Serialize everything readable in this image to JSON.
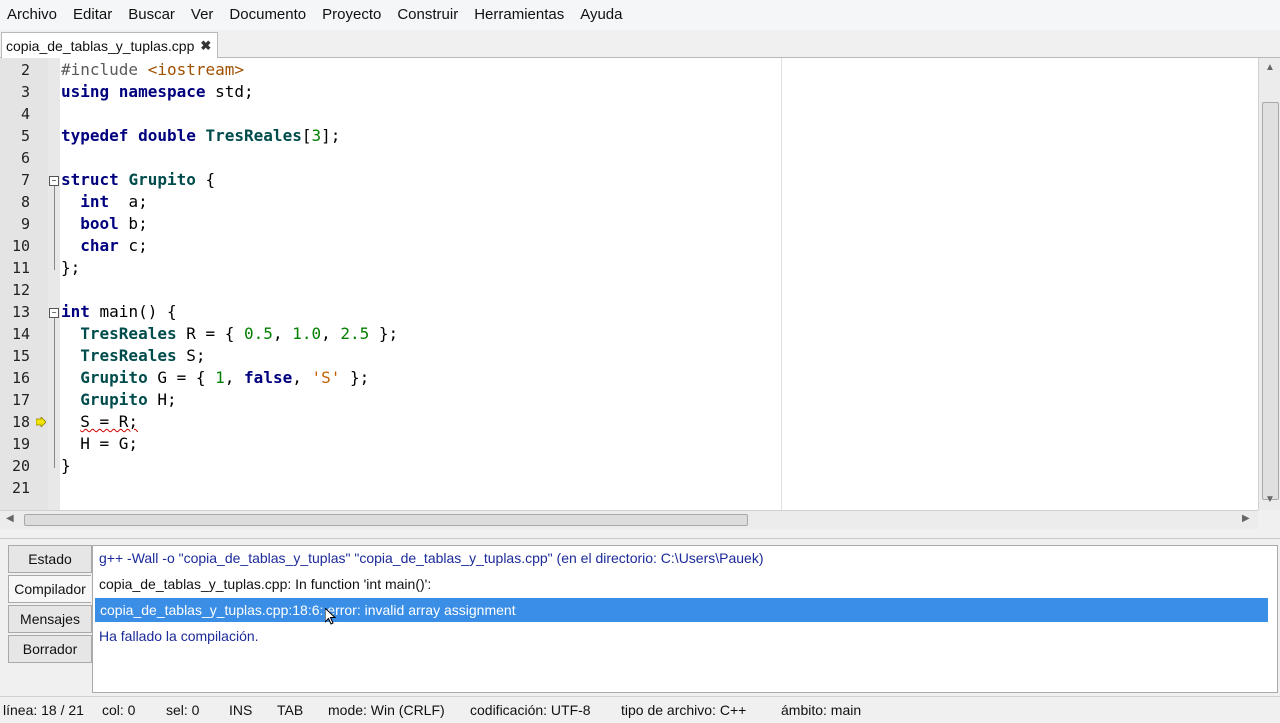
{
  "menu": [
    "Archivo",
    "Editar",
    "Buscar",
    "Ver",
    "Documento",
    "Proyecto",
    "Construir",
    "Herramientas",
    "Ayuda"
  ],
  "tab": {
    "filename": "copia_de_tablas_y_tuplas.cpp",
    "close": "✖"
  },
  "editor": {
    "line_numbers": [
      "2",
      "3",
      "4",
      "5",
      "6",
      "7",
      "8",
      "9",
      "10",
      "11",
      "12",
      "13",
      "14",
      "15",
      "16",
      "17",
      "18",
      "19",
      "20",
      "21"
    ],
    "code": {
      "l2a": "#include ",
      "l2b": "<iostream>",
      "l3a": "using namespace",
      "l3b": " std;",
      "l5a": "typedef double ",
      "l5b": "TresReales",
      "l5c": "[",
      "l5d": "3",
      "l5e": "];",
      "l7a": "struct ",
      "l7b": "Grupito",
      "l7c": " {",
      "l8a": "  int",
      "l8b": "  a;",
      "l9a": "  bool",
      "l9b": " b;",
      "l10a": "  char",
      "l10b": " c;",
      "l11": "};",
      "l13a": "int",
      "l13b": " main() {",
      "l14a": "  TresReales",
      "l14b": " R = { ",
      "l14c": "0.5",
      "l14d": ", ",
      "l14e": "1.0",
      "l14f": ", ",
      "l14g": "2.5",
      "l14h": " };",
      "l15a": "  TresReales",
      "l15b": " S;",
      "l16a": "  Grupito",
      "l16b": " G = { ",
      "l16c": "1",
      "l16d": ", ",
      "l16e": "false",
      "l16f": ", ",
      "l16g": "'S'",
      "l16h": " };",
      "l17a": "  Grupito",
      "l17b": " H;",
      "l18pre": "  ",
      "l18": "S = R;",
      "l19": "  H = G;",
      "l20": "}"
    }
  },
  "panel": {
    "tabs": [
      "Estado",
      "Compilador",
      "Mensajes",
      "Borrador"
    ],
    "active_tab": "Compilador",
    "messages": [
      "g++ -Wall -o \"copia_de_tablas_y_tuplas\" \"copia_de_tablas_y_tuplas.cpp\" (en el directorio: C:\\Users\\Pauek)",
      "copia_de_tablas_y_tuplas.cpp: In function 'int main()':",
      "copia_de_tablas_y_tuplas.cpp:18:6: error: invalid array assignment",
      "Ha fallado la compilación."
    ]
  },
  "status": {
    "line": "línea: 18 / 21",
    "col": "col: 0",
    "sel": "sel: 0",
    "ins": "INS",
    "tab": "TAB",
    "mode": "mode: Win (CRLF)",
    "encoding": "codificación: UTF-8",
    "filetype": "tipo de archivo: C++",
    "scope": "ámbito: main"
  },
  "icons": {
    "fold": "minus-box",
    "marker": "arrow-marker",
    "close": "close-x"
  }
}
